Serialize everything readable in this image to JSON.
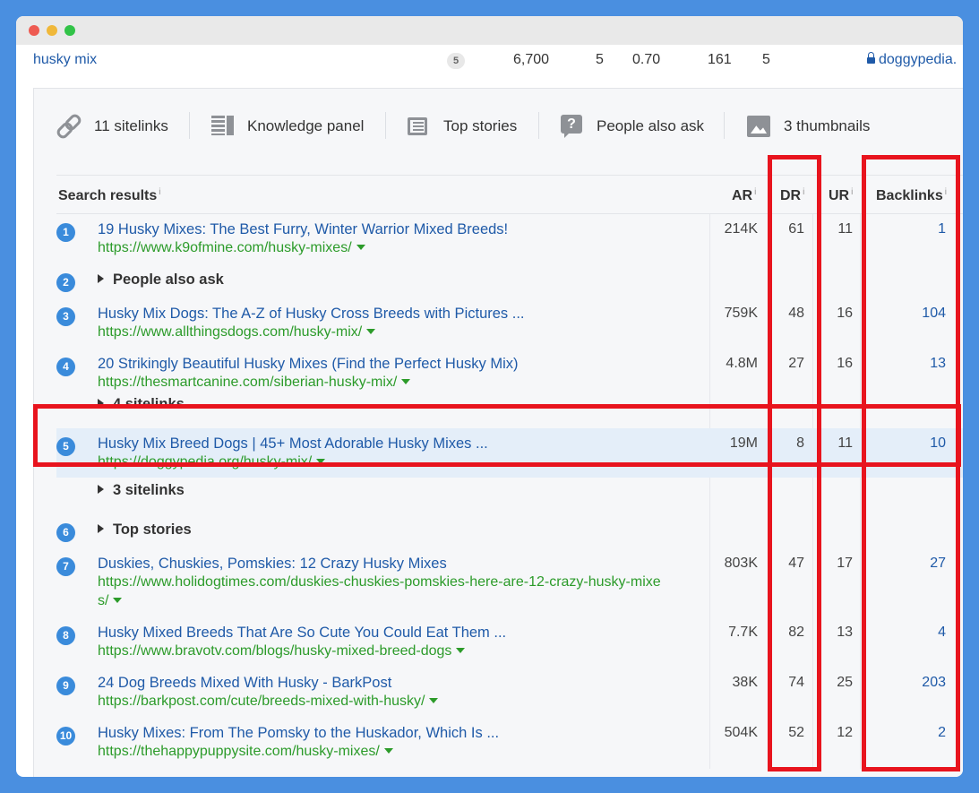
{
  "window": {
    "controls": [
      "close",
      "minimize",
      "maximize"
    ]
  },
  "top_row": {
    "keyword": "husky mix",
    "position": "5",
    "volume": "6,700",
    "kd": "5",
    "cpc": "0.70",
    "traffic": "161",
    "results": "5",
    "domain": "doggypedia."
  },
  "features": [
    {
      "label": "11 sitelinks",
      "icon": "link-icon"
    },
    {
      "label": "Knowledge panel",
      "icon": "knowledge-panel-icon"
    },
    {
      "label": "Top stories",
      "icon": "newspaper-icon"
    },
    {
      "label": "People also ask",
      "icon": "question-icon"
    },
    {
      "label": "3 thumbnails",
      "icon": "image-icon"
    }
  ],
  "headers": {
    "search_results": "Search results",
    "ar": "AR",
    "dr": "DR",
    "ur": "UR",
    "backlinks": "Backlinks",
    "info": "i"
  },
  "results": [
    {
      "n": "1",
      "title": "19 Husky Mixes: The Best Furry, Winter Warrior Mixed Breeds!",
      "url": "https://www.k9ofmine.com/husky-mixes/",
      "ar": "214K",
      "dr": "61",
      "ur": "11",
      "backlinks": "1"
    },
    {
      "n": "2",
      "feature": "People also ask"
    },
    {
      "n": "3",
      "title": "Husky Mix Dogs: The A-Z of Husky Cross Breeds with Pictures ...",
      "url": "https://www.allthingsdogs.com/husky-mix/",
      "ar": "759K",
      "dr": "48",
      "ur": "16",
      "backlinks": "104"
    },
    {
      "n": "4",
      "title": "20 Strikingly Beautiful Husky Mixes (Find the Perfect Husky Mix)",
      "url": "https://thesmartcanine.com/siberian-husky-mix/",
      "ar": "4.8M",
      "dr": "27",
      "ur": "16",
      "backlinks": "13",
      "sitelinks": "4 sitelinks"
    },
    {
      "n": "5",
      "title": "Husky Mix Breed Dogs | 45+ Most Adorable Husky Mixes ...",
      "url": "https://doggypedia.org/husky-mix/",
      "ar": "19M",
      "dr": "8",
      "ur": "11",
      "backlinks": "10",
      "sitelinks": "3 sitelinks",
      "highlighted": true
    },
    {
      "n": "6",
      "feature": "Top stories"
    },
    {
      "n": "7",
      "title": "Duskies, Chuskies, Pomskies: 12 Crazy Husky Mixes",
      "url": "https://www.holidogtimes.com/duskies-chuskies-pomskies-here-are-12-crazy-husky-mixe",
      "url_cont": "s/",
      "ar": "803K",
      "dr": "47",
      "ur": "17",
      "backlinks": "27"
    },
    {
      "n": "8",
      "title": "Husky Mixed Breeds That Are So Cute You Could Eat Them ...",
      "url": "https://www.bravotv.com/blogs/husky-mixed-breed-dogs",
      "ar": "7.7K",
      "dr": "82",
      "ur": "13",
      "backlinks": "4"
    },
    {
      "n": "9",
      "title": "24 Dog Breeds Mixed With Husky - BarkPost",
      "url": "https://barkpost.com/cute/breeds-mixed-with-husky/",
      "ar": "38K",
      "dr": "74",
      "ur": "25",
      "backlinks": "203"
    },
    {
      "n": "10",
      "title": "Husky Mixes: From The Pomsky to the Huskador, Which Is ...",
      "url": "https://thehappypuppysite.com/husky-mixes/",
      "ar": "504K",
      "dr": "52",
      "ur": "12",
      "backlinks": "2"
    }
  ],
  "colors": {
    "highlight": "#e8141e",
    "link": "#1f5aa8",
    "url": "#2c9b2a",
    "badge": "#3a8bdb",
    "frame": "#4a8fe0"
  }
}
